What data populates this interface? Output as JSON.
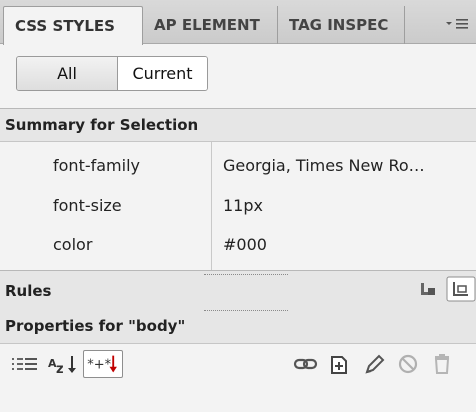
{
  "tabs": [
    {
      "label": "CSS STYLES",
      "active": true
    },
    {
      "label": "AP ELEMENT",
      "active": false
    },
    {
      "label": "TAG INSPEC",
      "active": false
    }
  ],
  "panel_menu_icon": "panel-options-icon",
  "mode_toggle": {
    "all_label": "All",
    "current_label": "Current",
    "selected": "Current"
  },
  "summary": {
    "title": "Summary for Selection",
    "rows": [
      {
        "property": "font-family",
        "value": "Georgia, Times New Ro…"
      },
      {
        "property": "font-size",
        "value": "11px"
      },
      {
        "property": "color",
        "value": "#000"
      }
    ]
  },
  "rules": {
    "title": "Rules",
    "icons": [
      "show-cascade-icon",
      "show-info-icon"
    ]
  },
  "properties": {
    "title": "Properties for \"body\""
  },
  "toolbar": {
    "icons": [
      "category-view-icon",
      "alpha-view-icon",
      "set-properties-view-icon",
      "attach-stylesheet-icon",
      "new-css-rule-icon",
      "edit-style-icon",
      "disable-property-icon",
      "delete-rule-icon"
    ],
    "pressed": "set-properties-view-icon"
  },
  "colors": {
    "panel_bg": "#f3f3f3",
    "header_bg": "#e6e6e6",
    "delete_accent": "#c00000"
  }
}
